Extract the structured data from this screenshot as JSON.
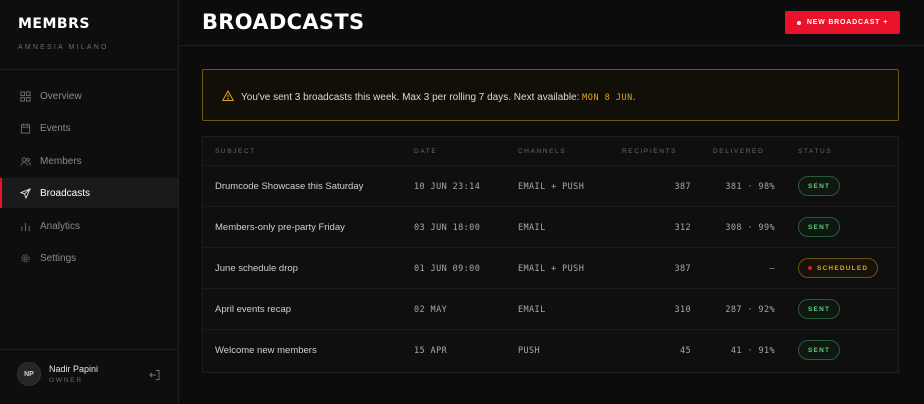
{
  "sidebar": {
    "brand": "MEMBRS",
    "venue": "AMNESIA MILANO",
    "nav": [
      {
        "label": "Overview",
        "icon": "grid-icon",
        "active": false
      },
      {
        "label": "Events",
        "icon": "calendar-icon",
        "active": false
      },
      {
        "label": "Members",
        "icon": "users-icon",
        "active": false
      },
      {
        "label": "Broadcasts",
        "icon": "send-icon",
        "active": true
      },
      {
        "label": "Analytics",
        "icon": "bar-chart-icon",
        "active": false
      },
      {
        "label": "Settings",
        "icon": "gear-icon",
        "active": false
      }
    ],
    "user": {
      "initials": "NP",
      "name": "Nadir Papini",
      "role": "OWNER"
    }
  },
  "header": {
    "title": "BROADCASTS",
    "new_button": "NEW BROADCAST",
    "new_button_arrow": "+"
  },
  "alert": {
    "text": "You've sent 3 broadcasts this week. Max 3 per rolling 7 days. Next available: ",
    "next_date": "MON 8 JUN",
    "suffix": "."
  },
  "table": {
    "columns": [
      "SUBJECT",
      "DATE",
      "CHANNELS",
      "RECIPIENTS",
      "DELIVERED",
      "STATUS"
    ],
    "rows": [
      {
        "subject": "Drumcode Showcase this Saturday",
        "date": "10 JUN 23:14",
        "channels": "EMAIL + PUSH",
        "recipients": "387",
        "delivered": "381 · 98%",
        "status": "SENT"
      },
      {
        "subject": "Members-only pre-party Friday",
        "date": "03 JUN 18:00",
        "channels": "EMAIL",
        "recipients": "312",
        "delivered": "308 · 99%",
        "status": "SENT"
      },
      {
        "subject": "June schedule drop",
        "date": "01 JUN 09:00",
        "channels": "EMAIL + PUSH",
        "recipients": "387",
        "delivered": "—",
        "status": "SCHEDULED"
      },
      {
        "subject": "April events recap",
        "date": "02 MAY",
        "channels": "EMAIL",
        "recipients": "310",
        "delivered": "287 · 92%",
        "status": "SENT"
      },
      {
        "subject": "Welcome new members",
        "date": "15 APR",
        "channels": "PUSH",
        "recipients": "45",
        "delivered": "41 · 91%",
        "status": "SENT"
      }
    ]
  },
  "colors": {
    "accent": "#e8122a",
    "warning": "#e0a516",
    "success": "#5dd07a",
    "background": "#0c0c0c"
  }
}
